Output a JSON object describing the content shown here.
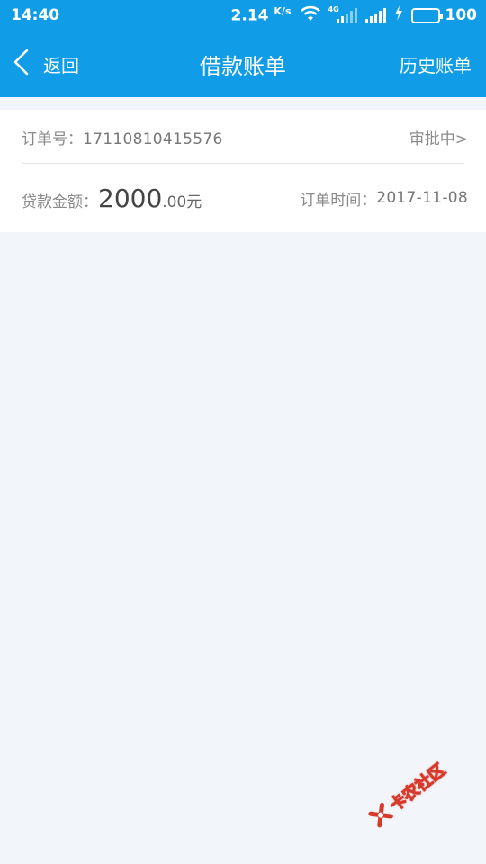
{
  "status_bar": {
    "time": "14:40",
    "speed": "2.14",
    "speed_unit": "K/s",
    "network_type": "4G",
    "battery": "100",
    "icons": [
      "wifi-icon",
      "signal-4g-icon",
      "signal-icon",
      "charging-icon",
      "battery-icon"
    ]
  },
  "nav": {
    "back_label": "返回",
    "title": "借款账单",
    "history_label": "历史账单",
    "back_icon": "chevron-left-icon"
  },
  "order": {
    "number_label": "订单号：",
    "number_value": "17110810415576",
    "status": "审批中>",
    "amount_label": "贷款金额：",
    "amount_int": "2000",
    "amount_dec": ".00元",
    "time_label": "订单时间：",
    "time_value": "2017-11-08"
  },
  "watermark": {
    "text": "卡农社区"
  },
  "colors": {
    "header_blue": "#109ce6",
    "background": "#f2f5fa",
    "card": "#ffffff",
    "watermark_red": "#d63a2a"
  }
}
